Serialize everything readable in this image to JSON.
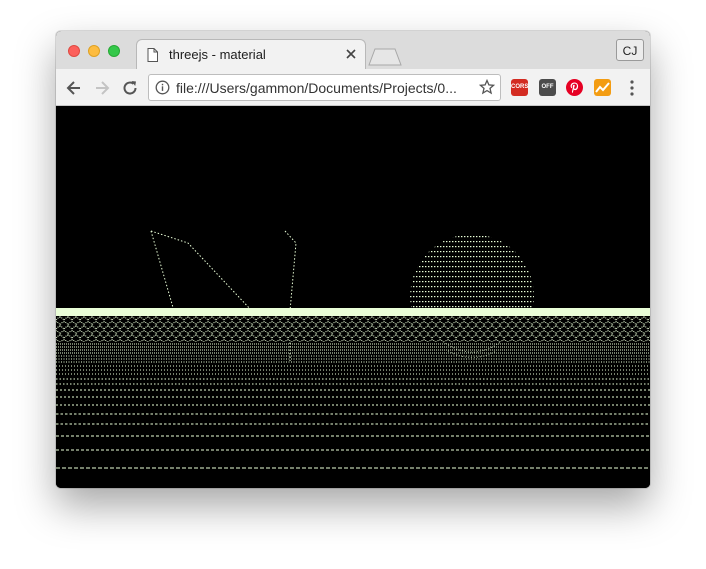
{
  "window": {
    "tab_title": "threejs - material",
    "profile_initials": "CJ"
  },
  "toolbar": {
    "url": "file:///Users/gammon/Documents/Projects/0..."
  },
  "extensions": [
    {
      "name": "cors-extension-icon",
      "label": "CORS",
      "color": "#d32b21"
    },
    {
      "name": "off-extension-icon",
      "label": "OFF",
      "color": "#4c4c4c"
    },
    {
      "name": "pinterest-icon",
      "color": "#e60023"
    },
    {
      "name": "trend-icon",
      "color": "#f39c12"
    }
  ],
  "scene": {
    "background": "#000000",
    "point_color": "#eaffd8",
    "objects": [
      "wireframe-cone",
      "point-sphere",
      "dotted-ground-plane"
    ]
  }
}
